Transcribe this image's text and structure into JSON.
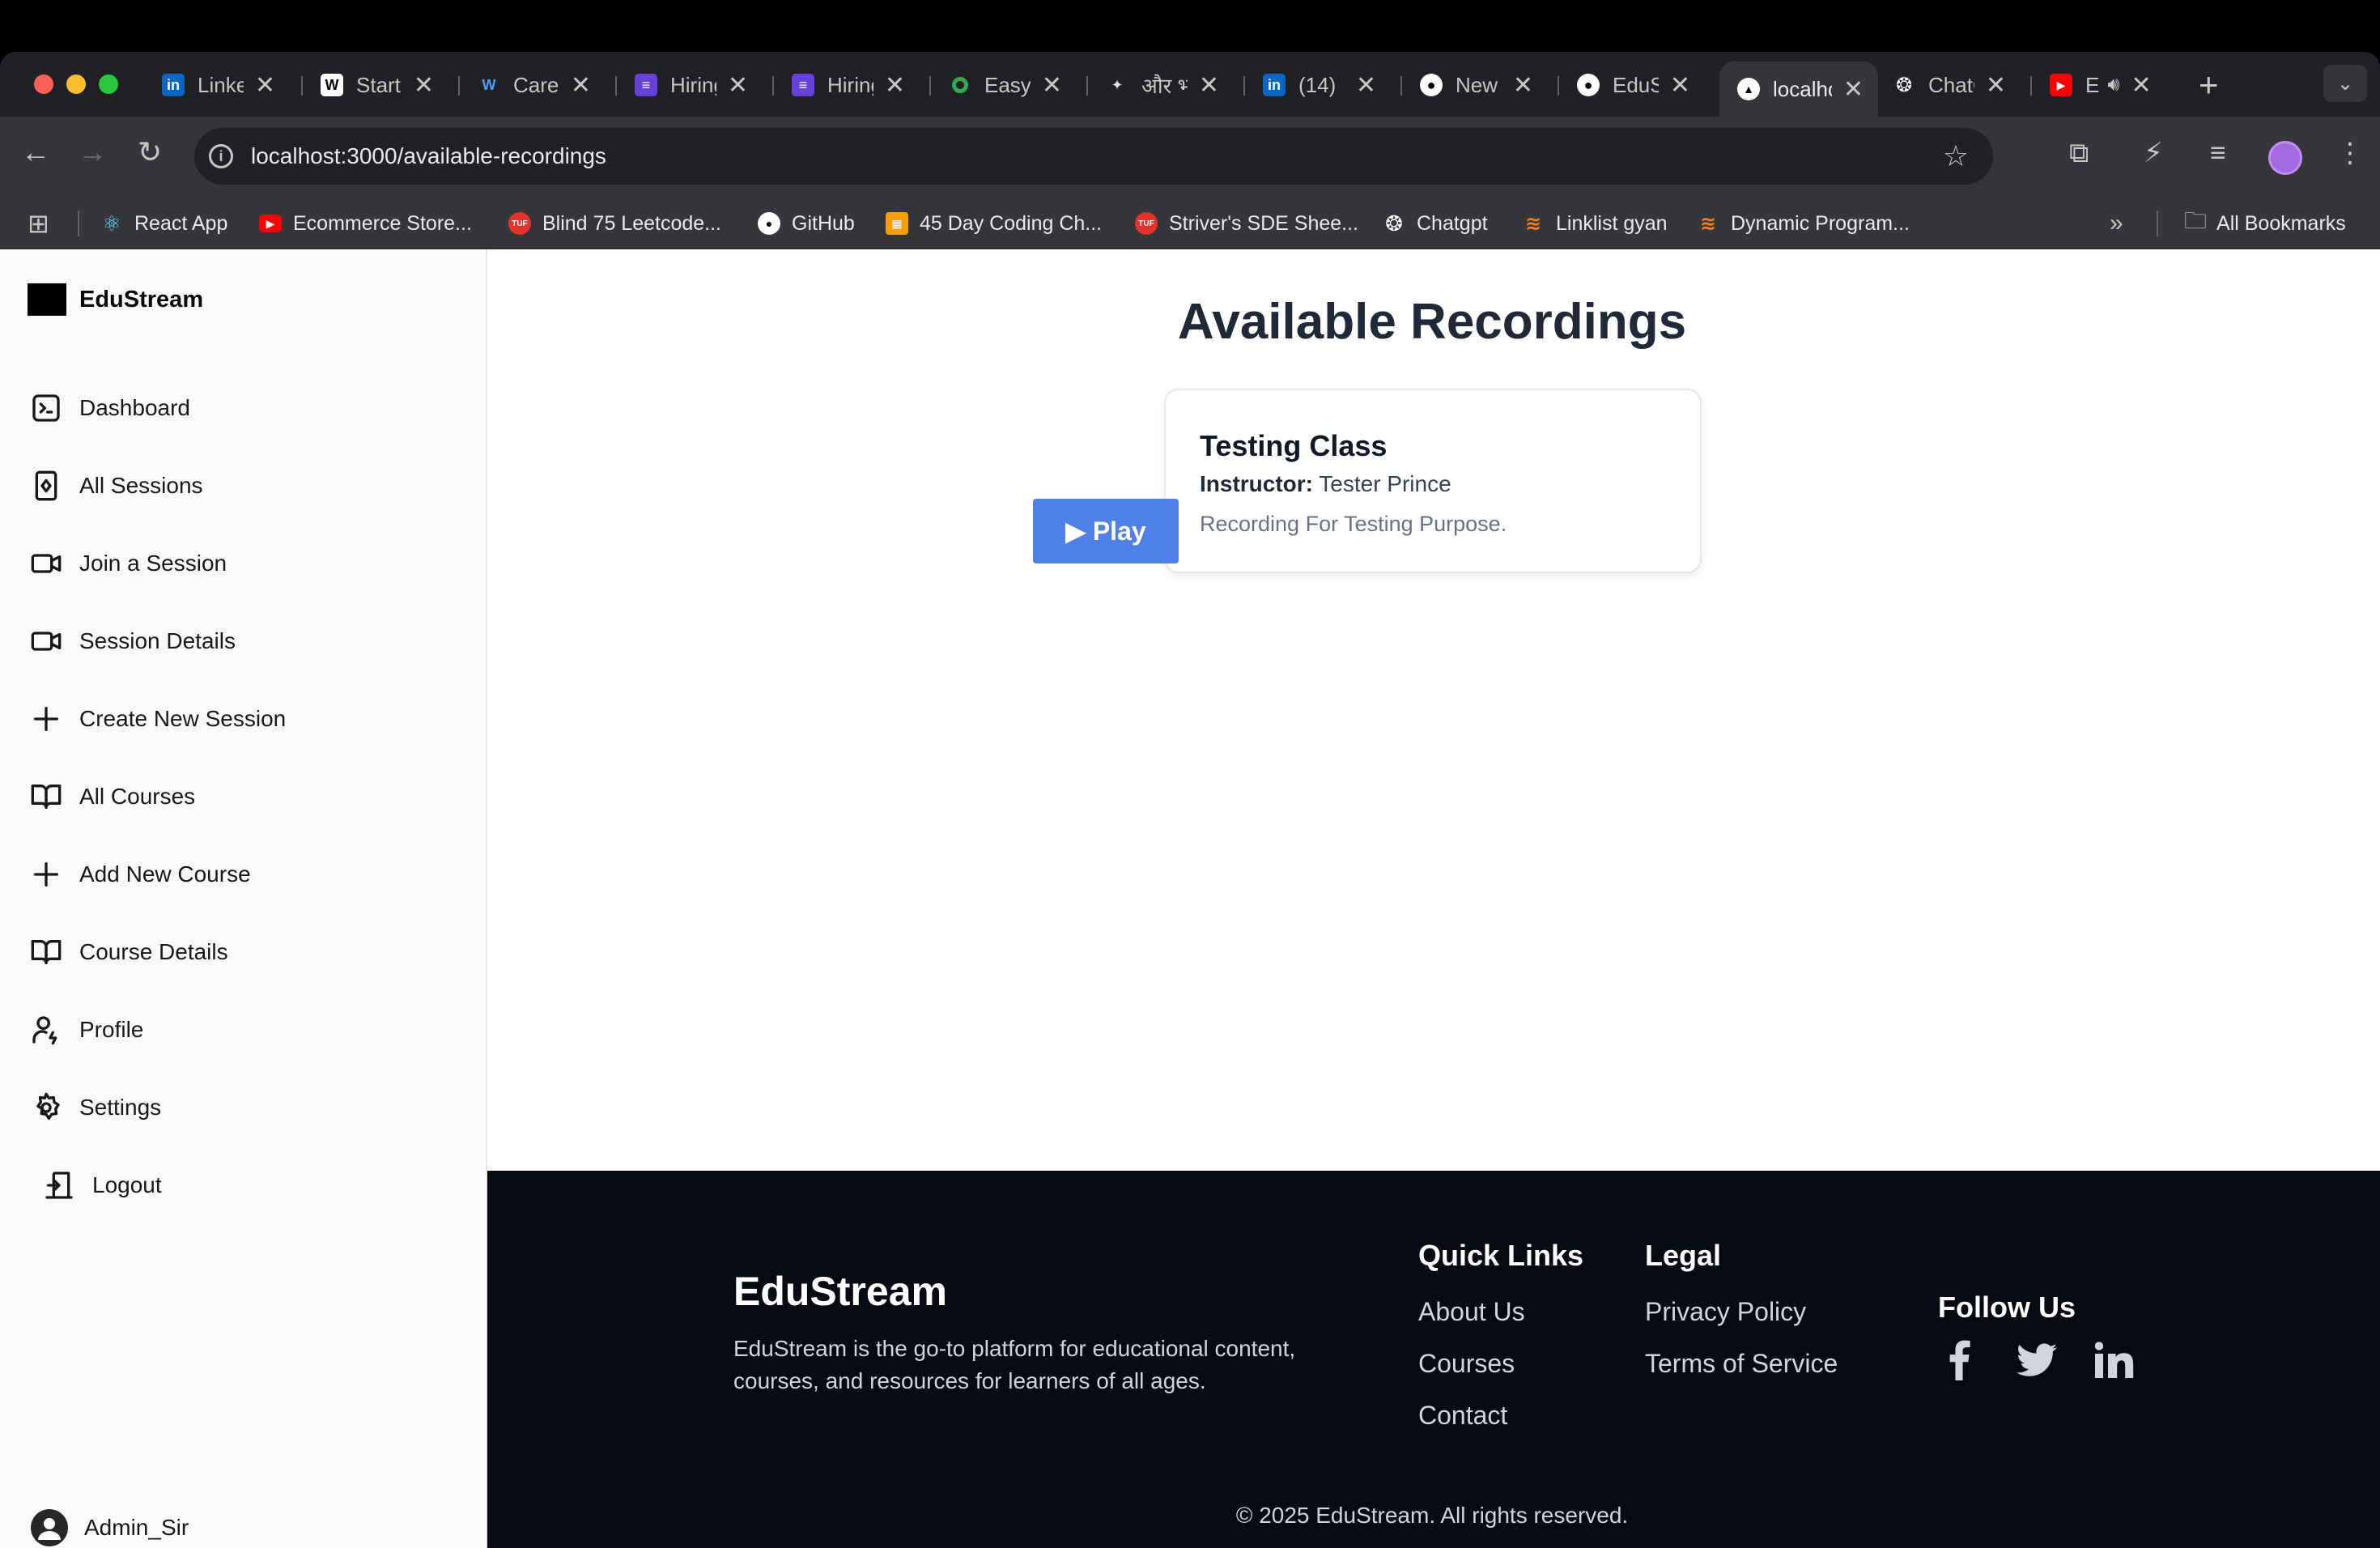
{
  "browser": {
    "tabs": [
      {
        "title": "LinkedIn",
        "favicon": "linkedin-icon",
        "color": "#0a66c2"
      },
      {
        "title": "Start",
        "favicon": "w-icon",
        "color": "#ffffff"
      },
      {
        "title": "Careers",
        "favicon": "wave-icon",
        "color": "#1a73e8"
      },
      {
        "title": "Hiring",
        "favicon": "form-icon",
        "color": "#6741d9"
      },
      {
        "title": "Hiring",
        "favicon": "form-icon",
        "color": "#6741d9"
      },
      {
        "title": "Easy",
        "favicon": "circle-icon",
        "color": "#34a853"
      },
      {
        "title": "और भी",
        "favicon": "bird-icon",
        "color": "#000000"
      },
      {
        "title": "(14)",
        "favicon": "linkedin-icon",
        "color": "#0a66c2"
      },
      {
        "title": "New",
        "favicon": "github-icon",
        "color": "#ffffff"
      },
      {
        "title": "EduStream",
        "favicon": "github-icon",
        "color": "#ffffff"
      },
      {
        "title": "localhost",
        "favicon": "triangle-icon",
        "color": "#ffffff",
        "active": true
      },
      {
        "title": "ChatGPT",
        "favicon": "openai-icon",
        "color": "#ffffff"
      },
      {
        "title": "E",
        "favicon": "youtube-icon",
        "color": "#ff0000",
        "audio": true
      }
    ],
    "url": "localhost:3000/available-recordings",
    "bookmarks": [
      {
        "label": "React App",
        "icon": "react-icon",
        "color": "#61dafb"
      },
      {
        "label": "Ecommerce Store...",
        "icon": "youtube-icon",
        "color": "#ff0000"
      },
      {
        "label": "Blind 75 Leetcode...",
        "icon": "tuf-icon",
        "color": "#e5322d"
      },
      {
        "label": "GitHub",
        "icon": "github-icon",
        "color": "#ffffff"
      },
      {
        "label": "45 Day Coding Ch...",
        "icon": "calendar-icon",
        "color": "#f59e0b"
      },
      {
        "label": "Striver's SDE Shee...",
        "icon": "tuf-icon",
        "color": "#e5322d"
      },
      {
        "label": "Chatgpt",
        "icon": "openai-icon",
        "color": "#ffffff"
      },
      {
        "label": "Linklist gyan",
        "icon": "stack-icon",
        "color": "#f48024"
      },
      {
        "label": "Dynamic Program...",
        "icon": "stack-icon",
        "color": "#f48024"
      }
    ],
    "all_bookmarks": "All Bookmarks"
  },
  "sidebar": {
    "brand": "EduStream",
    "items": [
      {
        "label": "Dashboard",
        "icon": "terminal-icon"
      },
      {
        "label": "All Sessions",
        "icon": "card-icon"
      },
      {
        "label": "Join a Session",
        "icon": "video-icon"
      },
      {
        "label": "Session Details",
        "icon": "video-icon"
      },
      {
        "label": "Create New Session",
        "icon": "plus-icon"
      },
      {
        "label": "All Courses",
        "icon": "book-icon"
      },
      {
        "label": "Add New Course",
        "icon": "plus-icon"
      },
      {
        "label": "Course Details",
        "icon": "book-icon"
      },
      {
        "label": "Profile",
        "icon": "user-icon"
      },
      {
        "label": "Settings",
        "icon": "gear-icon"
      },
      {
        "label": "Logout",
        "icon": "logout-icon"
      }
    ],
    "user": "Admin_Sir"
  },
  "main": {
    "title": "Available Recordings",
    "recording": {
      "title": "Testing Class",
      "instructor_label": "Instructor:",
      "instructor": "Tester Prince",
      "description": "Recording For Testing Purpose.",
      "play_label": "▶ Play"
    }
  },
  "footer": {
    "brand": "EduStream",
    "description": "EduStream is the go-to platform for educational content, courses, and resources for learners of all ages.",
    "quick_links_title": "Quick Links",
    "quick_links": [
      "About Us",
      "Courses",
      "Contact"
    ],
    "legal_title": "Legal",
    "legal_links": [
      "Privacy Policy",
      "Terms of Service"
    ],
    "follow_title": "Follow Us",
    "social": [
      "facebook-icon",
      "twitter-icon",
      "linkedin-icon"
    ],
    "copyright": "© 2025 EduStream. All rights reserved."
  },
  "colors": {
    "accent": "#4f7fe8",
    "footer_bg": "#070a12",
    "title": "#1f2937"
  }
}
